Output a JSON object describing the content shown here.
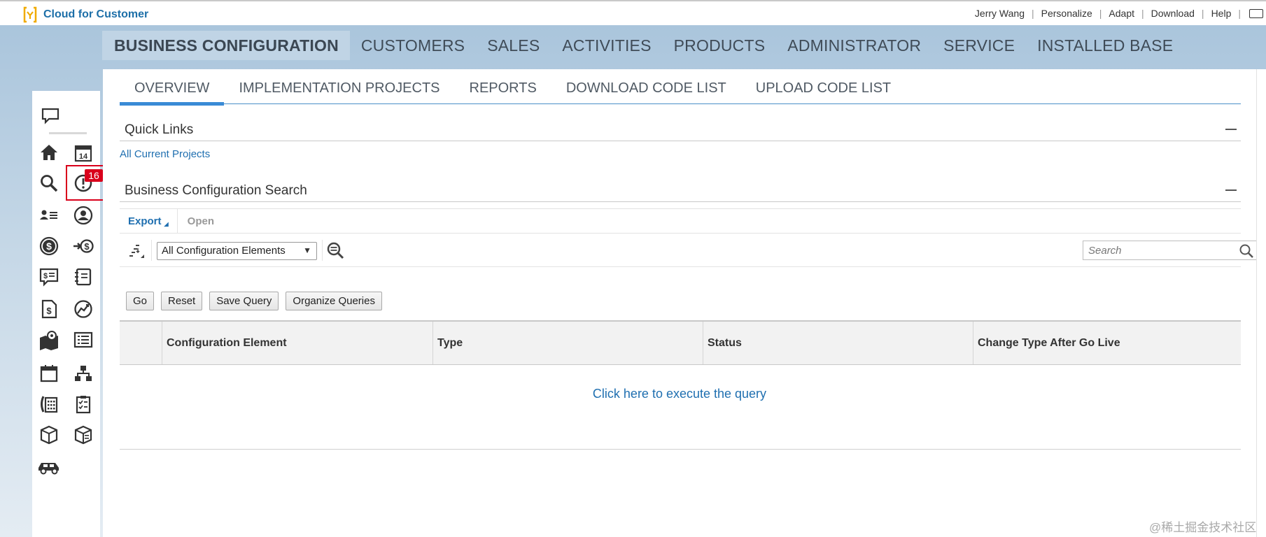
{
  "app": {
    "title": "Cloud for Customer"
  },
  "shell": {
    "links": [
      "Jerry Wang",
      "Personalize",
      "Adapt",
      "Download",
      "Help"
    ]
  },
  "topnav": {
    "items": [
      "BUSINESS CONFIGURATION",
      "CUSTOMERS",
      "SALES",
      "ACTIVITIES",
      "PRODUCTS",
      "ADMINISTRATOR",
      "SERVICE",
      "INSTALLED BASE"
    ],
    "active": "BUSINESS CONFIGURATION"
  },
  "subtabs": {
    "items": [
      "OVERVIEW",
      "IMPLEMENTATION PROJECTS",
      "REPORTS",
      "DOWNLOAD CODE LIST",
      "UPLOAD CODE LIST"
    ],
    "active": "OVERVIEW"
  },
  "rail": {
    "badge_count": "16",
    "icons": [
      "feedback-icon",
      "home-icon",
      "calendar-icon",
      "search-icon",
      "alert-icon",
      "contacts-icon",
      "account-icon",
      "money-icon",
      "lead-icon",
      "quote-icon",
      "notebook-icon",
      "invoice-icon",
      "forecast-icon",
      "map-icon",
      "list-icon",
      "calendar-small-icon",
      "org-chart-icon",
      "phone-book-icon",
      "checklist-icon",
      "product-icon",
      "catalog-icon",
      "car-icon"
    ]
  },
  "quick_links": {
    "title": "Quick Links",
    "link": "All Current Projects"
  },
  "search_section": {
    "title": "Business Configuration Search",
    "toolbar": {
      "export_label": "Export",
      "open_label": "Open"
    },
    "filter_select": "All Configuration Elements",
    "search_placeholder": "Search",
    "buttons": {
      "go": "Go",
      "reset": "Reset",
      "save_query": "Save Query",
      "organize_queries": "Organize Queries"
    },
    "columns": [
      "Configuration Element",
      "Type",
      "Status",
      "Change Type After Go Live"
    ],
    "execute_link": "Click here to execute the query"
  },
  "watermark": "@稀土掘金技术社区",
  "colors": {
    "brand_blue": "#1d6fa8",
    "logo_yellow": "#f0ab00",
    "badge_red": "#d9001b",
    "tab_blue": "#3a8bd6"
  }
}
